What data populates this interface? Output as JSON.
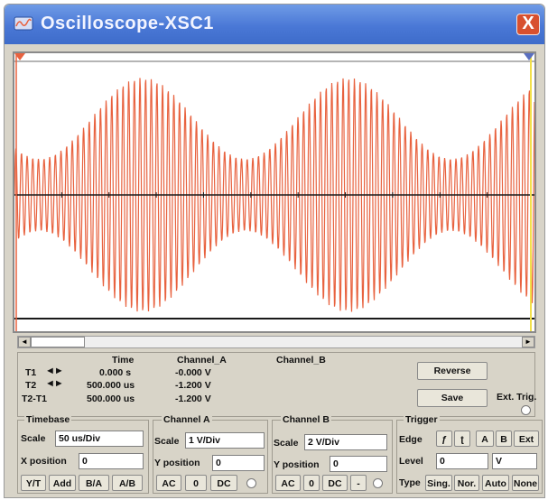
{
  "window": {
    "title": "Oscilloscope-XSC1",
    "close_label": "X",
    "accent": "#4a78d6",
    "close_color": "#d8502f"
  },
  "screen": {
    "background": "#ffffff",
    "trace_color": "#e8623f",
    "cursor_t1_color": "#e8623f",
    "cursor_t2_color": "#f2e04a",
    "waveform": "amplitude-modulated sine (AM)"
  },
  "scrollbar": {
    "left_label": "◄",
    "right_label": "►"
  },
  "readout": {
    "headers": {
      "time": "Time",
      "channel_a": "Channel_A",
      "channel_b": "Channel_B"
    },
    "rows": [
      {
        "label": "T1",
        "time": "0.000 s",
        "channel_a": "-0.000 V",
        "channel_b": ""
      },
      {
        "label": "T2",
        "time": "500.000 us",
        "channel_a": "-1.200 V",
        "channel_b": ""
      },
      {
        "label": "T2-T1",
        "time": "500.000 us",
        "channel_a": "-1.200 V",
        "channel_b": ""
      }
    ],
    "arrows_icon": "◄►"
  },
  "buttons": {
    "reverse": "Reverse",
    "save": "Save",
    "ext_trig": "Ext. Trig."
  },
  "timebase": {
    "title": "Timebase",
    "scale_label": "Scale",
    "scale_value": "50 us/Div",
    "xpos_label": "X position",
    "xpos_value": "0",
    "modes": [
      "Y/T",
      "Add",
      "B/A",
      "A/B"
    ]
  },
  "channel_a": {
    "title": "Channel A",
    "scale_label": "Scale",
    "scale_value": "1 V/Div",
    "ypos_label": "Y position",
    "ypos_value": "0",
    "coupling": [
      "AC",
      "0",
      "DC"
    ]
  },
  "channel_b": {
    "title": "Channel B",
    "scale_label": "Scale",
    "scale_value": "2 V/Div",
    "ypos_label": "Y position",
    "ypos_value": "0",
    "coupling": [
      "AC",
      "0",
      "DC",
      "-"
    ]
  },
  "trigger": {
    "title": "Trigger",
    "edge_label": "Edge",
    "edge_options": [
      "ƒ",
      "ʈ",
      "A",
      "B",
      "Ext"
    ],
    "level_label": "Level",
    "level_value": "0",
    "level_unit": "V",
    "type_label": "Type",
    "type_options": [
      "Sing.",
      "Nor.",
      "Auto",
      "None"
    ]
  }
}
